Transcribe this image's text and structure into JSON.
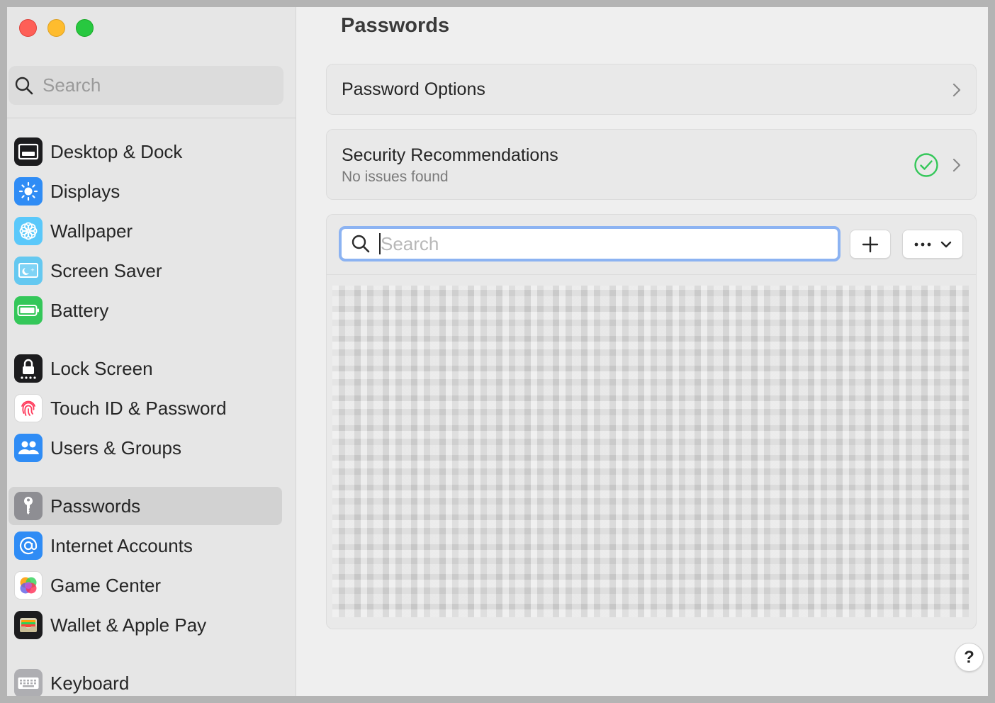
{
  "sidebar": {
    "search_placeholder": "Search",
    "items": [
      {
        "label": "Desktop & Dock",
        "icon": "desktop-dock-icon",
        "color": "#1c1c1e"
      },
      {
        "label": "Displays",
        "icon": "displays-icon",
        "color": "#2f8cf5"
      },
      {
        "label": "Wallpaper",
        "icon": "wallpaper-icon",
        "color": "#5ac8fa"
      },
      {
        "label": "Screen Saver",
        "icon": "screen-saver-icon",
        "color": "#64c8f0"
      },
      {
        "label": "Battery",
        "icon": "battery-icon",
        "color": "#34c759"
      },
      {
        "label": "Lock Screen",
        "icon": "lock-icon",
        "color": "#1c1c1e"
      },
      {
        "label": "Touch ID & Password",
        "icon": "fingerprint-icon",
        "color": "#ffffff"
      },
      {
        "label": "Users & Groups",
        "icon": "users-icon",
        "color": "#2f8cf5"
      },
      {
        "label": "Passwords",
        "icon": "key-icon",
        "color": "#8e8e93",
        "selected": true
      },
      {
        "label": "Internet Accounts",
        "icon": "at-icon",
        "color": "#2f8cf5"
      },
      {
        "label": "Game Center",
        "icon": "game-center-icon",
        "color": "#ffffff"
      },
      {
        "label": "Wallet & Apple Pay",
        "icon": "wallet-icon",
        "color": "#1c1c1e"
      },
      {
        "label": "Keyboard",
        "icon": "keyboard-icon",
        "color": "#aeaeb2"
      }
    ]
  },
  "main": {
    "title": "Passwords",
    "password_options": {
      "label": "Password Options"
    },
    "security": {
      "label": "Security Recommendations",
      "status": "No issues found",
      "status_color": "#34c759"
    },
    "search_placeholder": "Search",
    "add_icon": "plus-icon",
    "more_icon": "ellipsis-icon",
    "help_label": "?"
  }
}
